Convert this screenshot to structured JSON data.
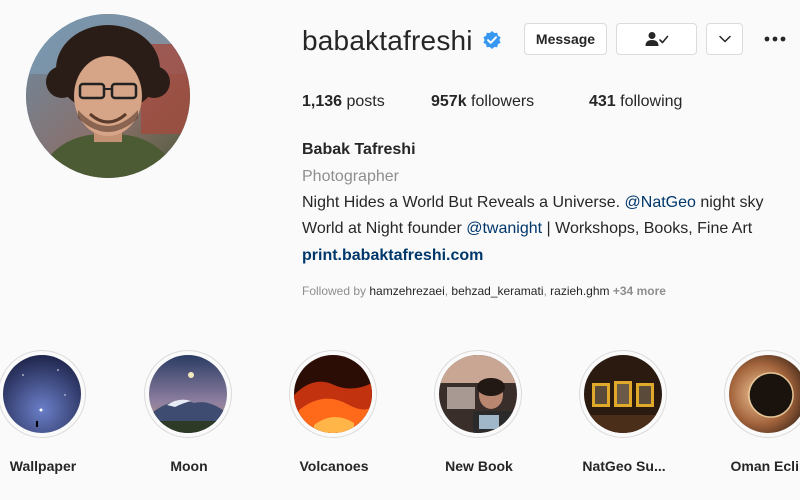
{
  "profile": {
    "username": "babaktafreshi",
    "verified_icon": "verified-badge-icon",
    "accent_color": "#3897f0"
  },
  "actions": {
    "message_label": "Message",
    "following_icon": "person-check-icon",
    "dropdown_icon": "chevron-down-icon",
    "more_icon": "more-dots-icon"
  },
  "stats": {
    "posts_count": "1,136",
    "posts_label": "posts",
    "followers_count": "957k",
    "followers_label": "followers",
    "following_count": "431",
    "following_label": "following"
  },
  "bio": {
    "full_name": "Babak Tafreshi",
    "category": "Photographer",
    "line1_text": "Night Hides a World But Reveals a Universe. ",
    "line1_mention": "@NatGeo",
    "line1_rest": " night sky",
    "line2_text": "World at Night founder ",
    "line2_mention": "@twanight",
    "line2_rest": " | Workshops, Books, Fine Art",
    "website": "print.babaktafreshi.com",
    "followed_by_label": "Followed by ",
    "followed_by_users": [
      "hamzehrezaei",
      "behzad_keramati",
      "razieh.ghm"
    ],
    "followed_by_more": "+34 more"
  },
  "highlights": [
    {
      "label": "Wallpaper"
    },
    {
      "label": "Moon"
    },
    {
      "label": "Volcanoes"
    },
    {
      "label": "New Book"
    },
    {
      "label": "NatGeo Su..."
    },
    {
      "label": "Oman Eclip"
    }
  ]
}
